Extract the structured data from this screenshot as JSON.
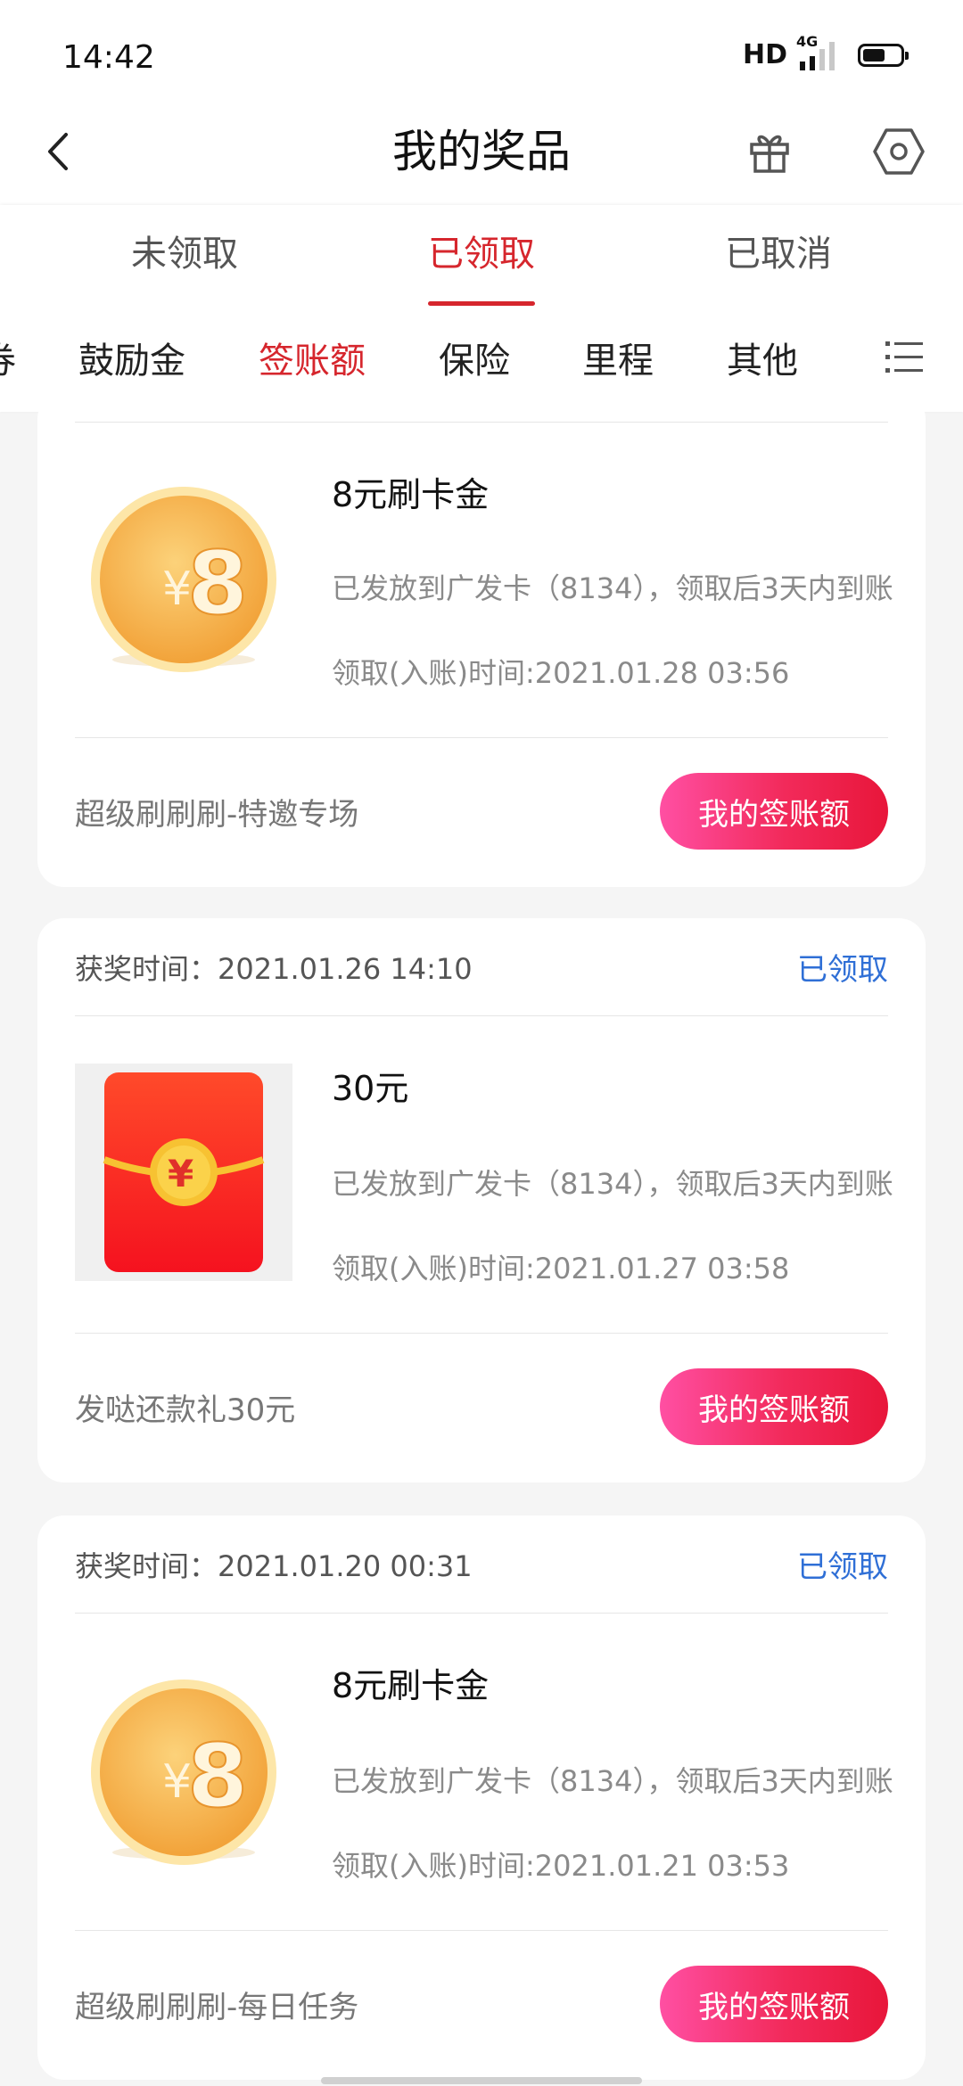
{
  "status_bar": {
    "time": "14:42",
    "hd": "HD",
    "network": "4G"
  },
  "nav": {
    "title": "我的奖品"
  },
  "status_tabs": [
    {
      "label": "未领取",
      "active": false
    },
    {
      "label": "已领取",
      "active": true
    },
    {
      "label": "已取消",
      "active": false
    }
  ],
  "category_tabs": {
    "partial": "券",
    "items": [
      {
        "label": "鼓励金",
        "active": false
      },
      {
        "label": "签账额",
        "active": true
      },
      {
        "label": "保险",
        "active": false
      },
      {
        "label": "里程",
        "active": false
      },
      {
        "label": "其他",
        "active": false
      }
    ]
  },
  "cards": [
    {
      "award_time": "",
      "status": "",
      "image": "gold-coin-icon",
      "coin_value": "8",
      "name": "8元刷卡金",
      "desc": "已发放到广发卡（8134），领取后3天内到账",
      "claim_time": "领取(入账)时间:2021.01.28 03:56",
      "activity": "超级刷刷刷-特邀专场",
      "button": "我的签账额"
    },
    {
      "award_time": "获奖时间：2021.01.26 14:10",
      "status": "已领取",
      "image": "red-envelope-icon",
      "name": "30元",
      "desc": "已发放到广发卡（8134），领取后3天内到账",
      "claim_time": "领取(入账)时间:2021.01.27 03:58",
      "activity": "发哒还款礼30元",
      "button": "我的签账额"
    },
    {
      "award_time": "获奖时间：2021.01.20 00:31",
      "status": "已领取",
      "image": "gold-coin-icon",
      "coin_value": "8",
      "name": "8元刷卡金",
      "desc": "已发放到广发卡（8134），领取后3天内到账",
      "claim_time": "领取(入账)时间:2021.01.21 03:53",
      "activity": "超级刷刷刷-每日任务",
      "button": "我的签账额"
    }
  ],
  "colors": {
    "accent": "#d6262d",
    "status_blue": "#2f6fd6",
    "button_start": "#ff4fa3",
    "button_end": "#e8163a"
  }
}
